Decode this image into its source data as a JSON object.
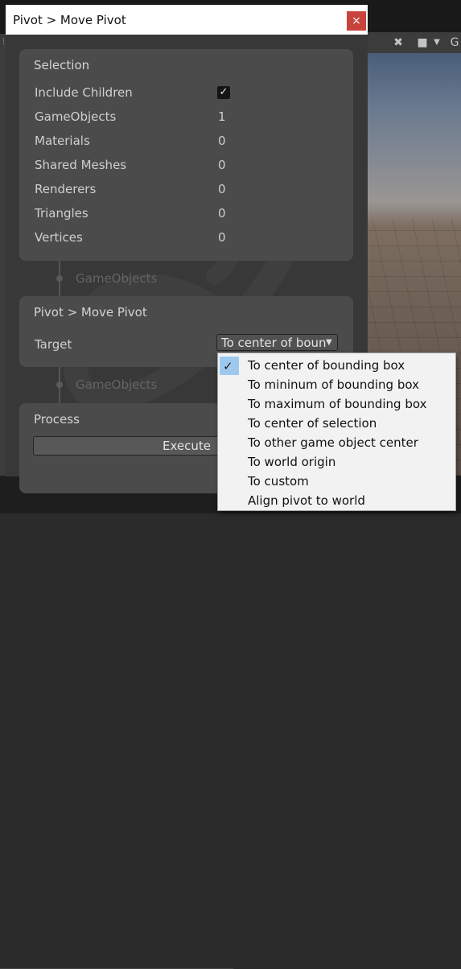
{
  "window": {
    "title": "Pivot > Move Pivot",
    "close_glyph": "×"
  },
  "selection": {
    "title": "Selection",
    "include_children": {
      "label": "Include Children",
      "checked": true,
      "check_glyph": "✓"
    },
    "rows": [
      {
        "label": "GameObjects",
        "value": "1"
      },
      {
        "label": "Materials",
        "value": "0"
      },
      {
        "label": "Shared Meshes",
        "value": "0"
      },
      {
        "label": "Renderers",
        "value": "0"
      },
      {
        "label": "Triangles",
        "value": "0"
      },
      {
        "label": "Vertices",
        "value": "0"
      }
    ]
  },
  "connectors": [
    {
      "label": "GameObjects"
    },
    {
      "label": "GameObjects"
    }
  ],
  "pivot": {
    "title": "Pivot > Move Pivot",
    "target_label": "Target",
    "target_value": "To center of boun",
    "arrow": "▼"
  },
  "process": {
    "title": "Process",
    "execute_label": "Execute"
  },
  "menu": {
    "selected_index": 0,
    "check_glyph": "✓",
    "items": [
      "To center of bounding box",
      "To mininum of bounding box",
      "To maximum of bounding box",
      "To center of selection",
      "To other game object center",
      "To world origin",
      "To custom",
      "Align pivot to world"
    ]
  },
  "editor": {
    "toolbar_icons": [
      "tools-icon",
      "camera-icon",
      "dropdown-arrow-icon",
      "gizmos-icon"
    ],
    "toolbar_glyphs": {
      "tools": "✖",
      "camera": "■",
      "arrow": "▼",
      "gizmos": "G"
    },
    "left_dots": "⋮"
  },
  "colors": {
    "close_button": "#c9423c",
    "menu_highlight": "#9ec9ef",
    "panel": "#4b4b4b",
    "window": "#383838"
  }
}
